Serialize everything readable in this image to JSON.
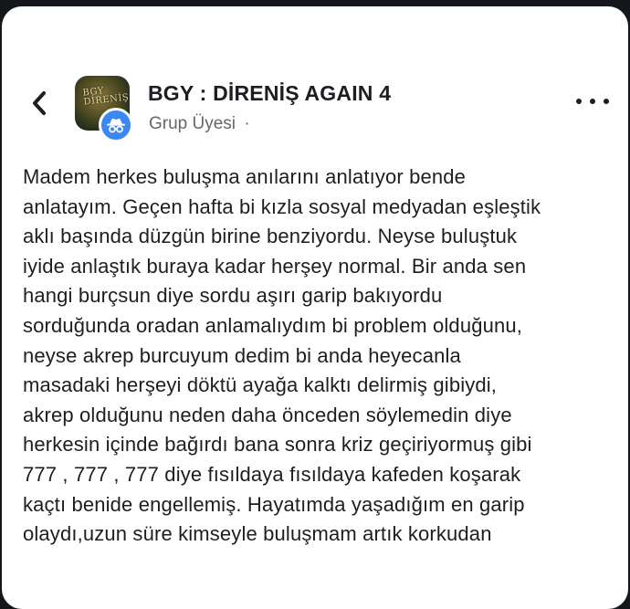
{
  "post": {
    "group_name": "BGY : DİRENİŞ AGAIN 4",
    "role": "Grup Üyesi",
    "separator": "·",
    "avatar_text": [
      "BGY",
      "DİRENİŞ"
    ],
    "icons": {
      "back": "chevron-left-icon",
      "badge": "anonymous-member-icon",
      "more": "more-options-icon"
    },
    "colors": {
      "badge": "#3b88f5",
      "text": "#1c1e21",
      "meta": "#65676b"
    },
    "body_lines": [
      "Madem herkes buluşma anılarını anlatıyor bende",
      "anlatayım. Geçen hafta bi kızla sosyal medyadan eşleştik",
      "aklı başında düzgün birine benziyordu. Neyse buluştuk",
      "iyide anlaştık buraya kadar herşey normal. Bir anda sen",
      "hangi burçsun diye sordu aşırı garip bakıyordu",
      "sorduğunda oradan anlamalıydım bi problem olduğunu,",
      "neyse akrep burcuyum dedim bi anda heyecanla",
      "masadaki herşeyi döktü ayağa kalktı delirmiş gibiydi,",
      "akrep olduğunu neden daha önceden söylemedin diye",
      "herkesin içinde bağırdı bana sonra kriz geçiriyormuş gibi",
      "777 , 777 , 777 diye fısıldaya fısıldaya kafeden koşarak",
      "kaçtı benide engellemiş. Hayatımda yaşadığım en garip",
      "olaydı,uzun süre kimseyle buluşmam artık korkudan"
    ]
  }
}
